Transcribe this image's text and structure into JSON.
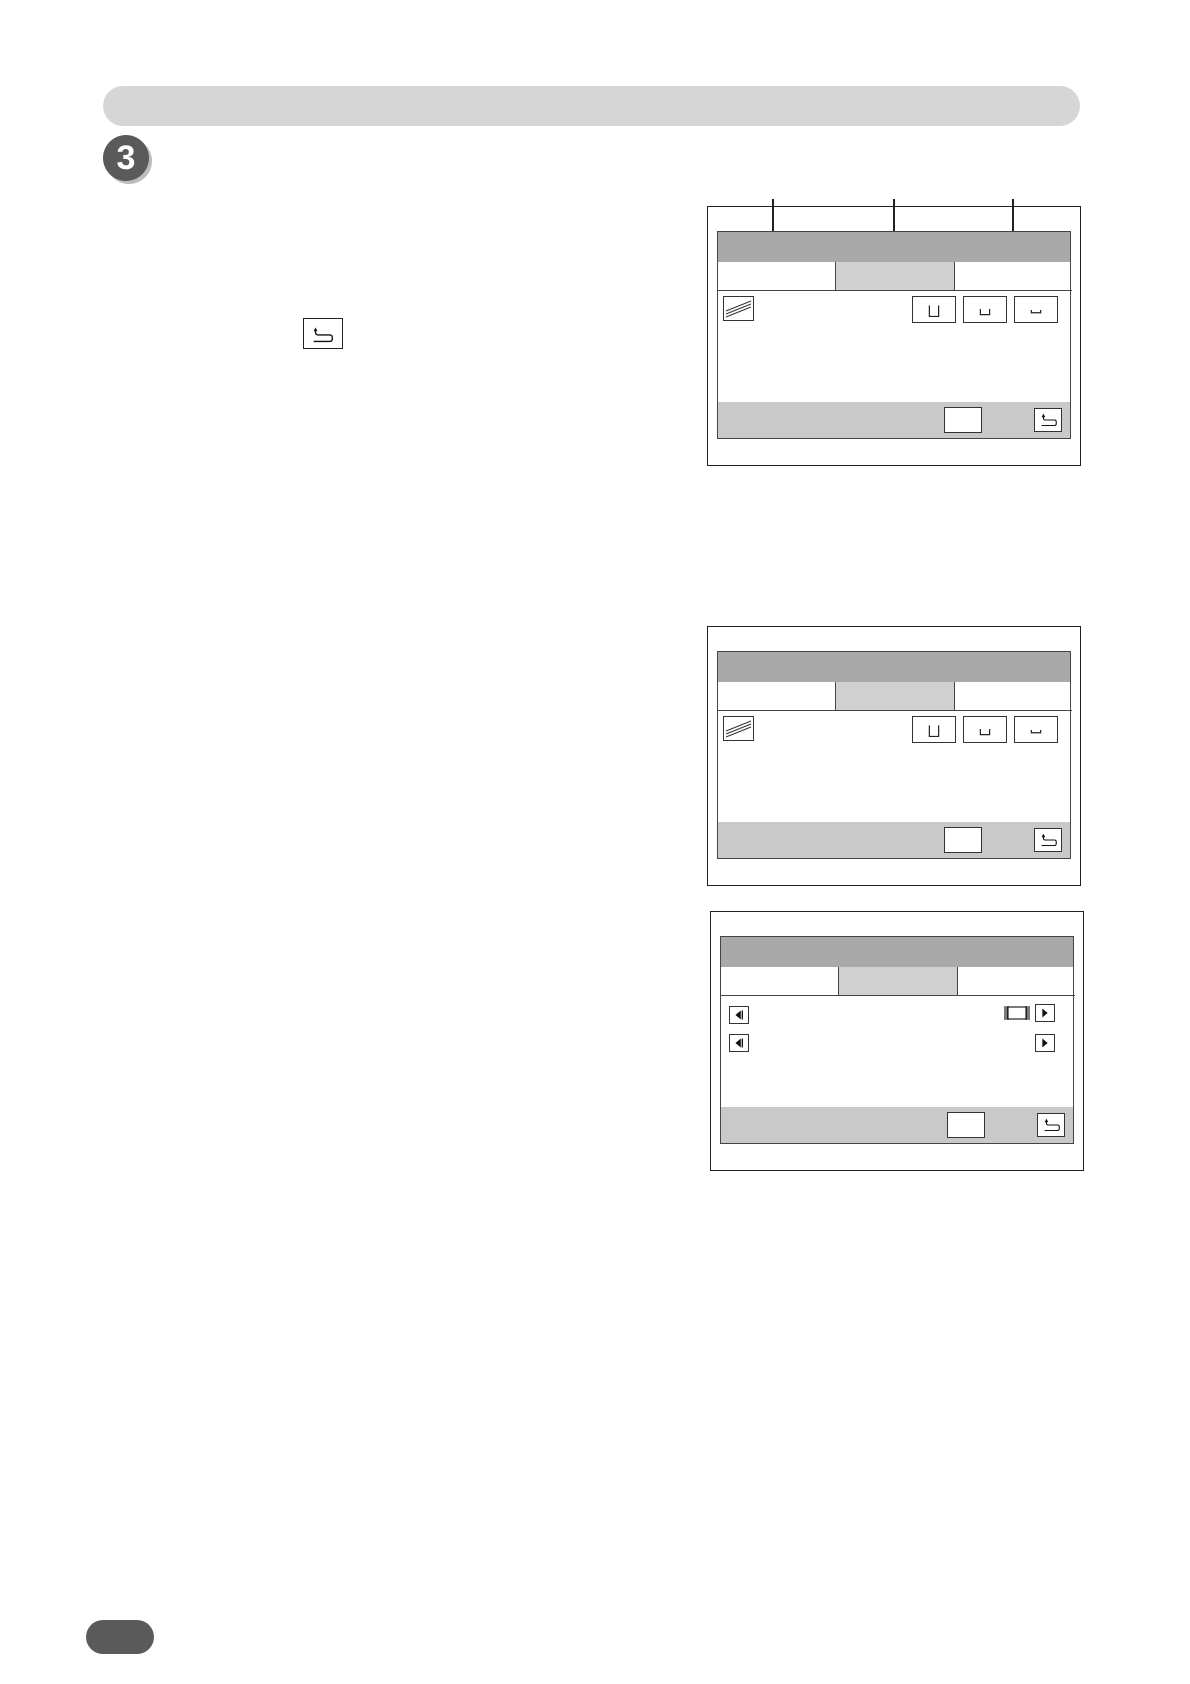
{
  "step": {
    "number": "3"
  },
  "icons": {
    "back": "return-arrow-icon",
    "paper": "paper-stack-icon",
    "tray": "tray-icon",
    "left_arrow": "left-arrow-icon",
    "right_arrow": "right-arrow-icon",
    "binding": "binding-icon"
  },
  "colors": {
    "header_bar": "#d6d6d6",
    "step_badge": "#5a5a5a",
    "title_bar": "#a9a9a9",
    "selected_tab": "#d0d0d0",
    "bottom_bar": "#c9c9c9"
  }
}
